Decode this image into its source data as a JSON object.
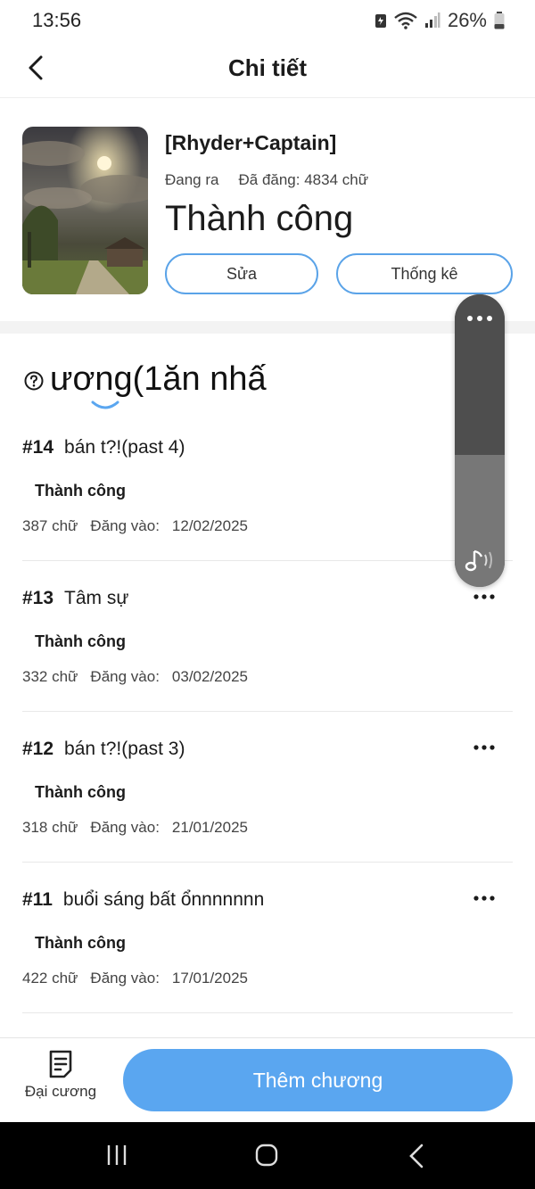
{
  "status_bar": {
    "time": "13:56",
    "battery": "26%"
  },
  "nav": {
    "title": "Chi tiết"
  },
  "book": {
    "title": "[Rhyder+Captain]",
    "state": "Đang ra",
    "posted_words": "Đã đăng: 4834 chữ",
    "status": "Thành công",
    "edit_label": "Sửa",
    "stats_label": "Thống kê"
  },
  "outline_heading": "ương(1ăn nhấ",
  "chapters": [
    {
      "num": "#14",
      "title": "bán t?!(past 4)",
      "status": "Thành công",
      "words": "387 chữ",
      "date_label": "Đăng vào:",
      "date": "12/02/2025"
    },
    {
      "num": "#13",
      "title": "Tâm sự",
      "status": "Thành công",
      "words": "332 chữ",
      "date_label": "Đăng vào:",
      "date": "03/02/2025"
    },
    {
      "num": "#12",
      "title": "bán t?!(past 3)",
      "status": "Thành công",
      "words": "318 chữ",
      "date_label": "Đăng vào:",
      "date": "21/01/2025"
    },
    {
      "num": "#11",
      "title": "buổi sáng bất ổnnnnnnn",
      "status": "Thành công",
      "words": "422 chữ",
      "date_label": "Đăng vào:",
      "date": "17/01/2025"
    }
  ],
  "bottom": {
    "outline_tab": "Đại cương",
    "add_chapter": "Thêm chương"
  },
  "colors": {
    "accent": "#5aa6f0",
    "border_accent": "#5aa3e8"
  }
}
